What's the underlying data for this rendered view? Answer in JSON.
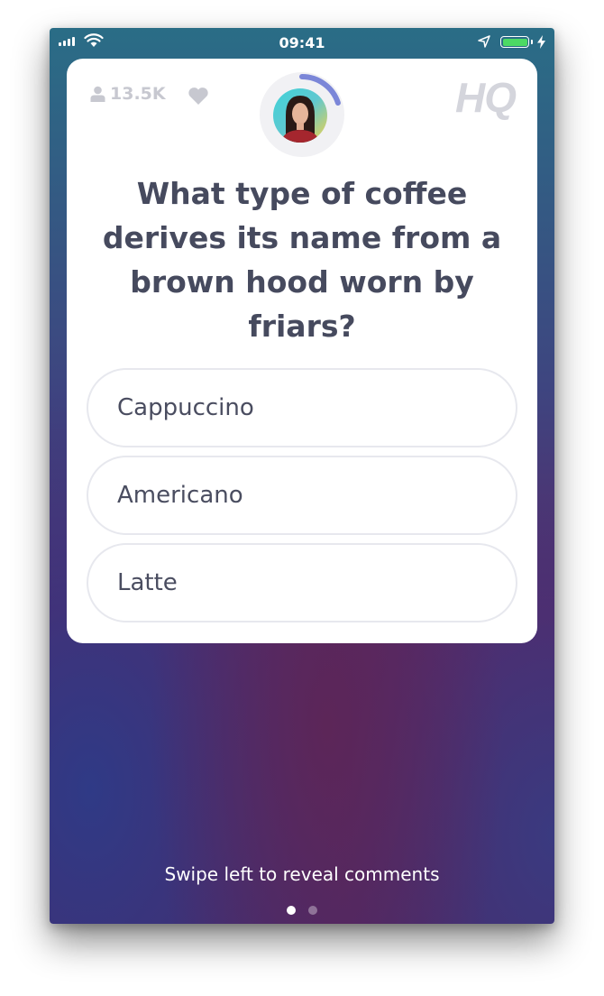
{
  "status_bar": {
    "time": "09:41",
    "battery_level": 1.0,
    "icons": [
      "signal-icon",
      "wifi-icon",
      "location-arrow-icon",
      "battery-icon",
      "charging-bolt-icon"
    ]
  },
  "game": {
    "viewer_count": "13.5K",
    "logo": "HQ",
    "timer_remaining_fraction": 0.2,
    "question": "What type of coffee derives its name from a brown hood worn by friars?",
    "answers": [
      {
        "label": "Cappuccino"
      },
      {
        "label": "Americano"
      },
      {
        "label": "Latte"
      }
    ]
  },
  "footer": {
    "swipe_hint": "Swipe left to reveal comments",
    "page_count": 2,
    "active_page": 1
  },
  "colors": {
    "question_text": "#464a5e",
    "answer_border": "#e7e8ee",
    "timer_arc": "#7b86d8",
    "battery_fill": "#4cd964",
    "muted": "#c7c8d0"
  }
}
